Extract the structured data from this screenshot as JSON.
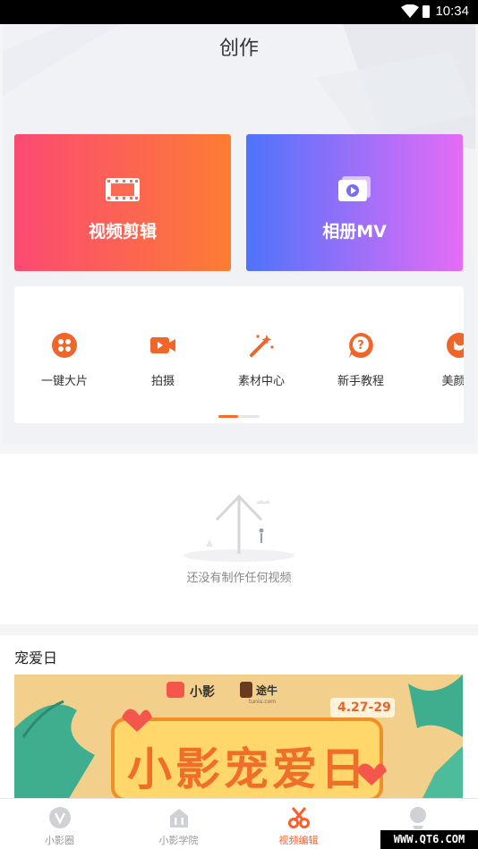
{
  "status_bar": {
    "time": "10:34",
    "icons": [
      "wifi-icon",
      "battery-icon"
    ]
  },
  "page_title": "创作",
  "cards": [
    {
      "label": "视频剪辑",
      "icon": "film-icon"
    },
    {
      "label": "相册MV",
      "icon": "album-play-icon"
    }
  ],
  "tools": [
    {
      "label": "一键大片",
      "icon": "dots-grid-icon"
    },
    {
      "label": "拍摄",
      "icon": "camera-icon"
    },
    {
      "label": "素材中心",
      "icon": "magic-wand-icon"
    },
    {
      "label": "新手教程",
      "icon": "question-icon"
    },
    {
      "label": "美颜滤",
      "icon": "beauty-icon"
    }
  ],
  "empty_state": {
    "message": "还没有制作任何视频"
  },
  "section": {
    "title": "宠爱日",
    "banner": {
      "brand_a": "小影",
      "brand_b": "途牛",
      "brand_b_sub": "tuniu.com",
      "date": "4.27-29",
      "headline": "小影宠爱日"
    }
  },
  "tabs": [
    {
      "label": "小影圈",
      "icon": "v-circle-icon"
    },
    {
      "label": "小影学院",
      "icon": "academy-icon"
    },
    {
      "label": "视频编辑",
      "icon": "scissors-icon"
    },
    {
      "label": "",
      "icon": "profile-icon"
    }
  ],
  "watermark": "WWW.QT6.COM",
  "colors": {
    "accent": "#fd5f2c",
    "edit_from": "#fb4a73",
    "edit_to": "#fd7c34",
    "album_from": "#4f73fb",
    "album_to": "#e56cf6"
  }
}
